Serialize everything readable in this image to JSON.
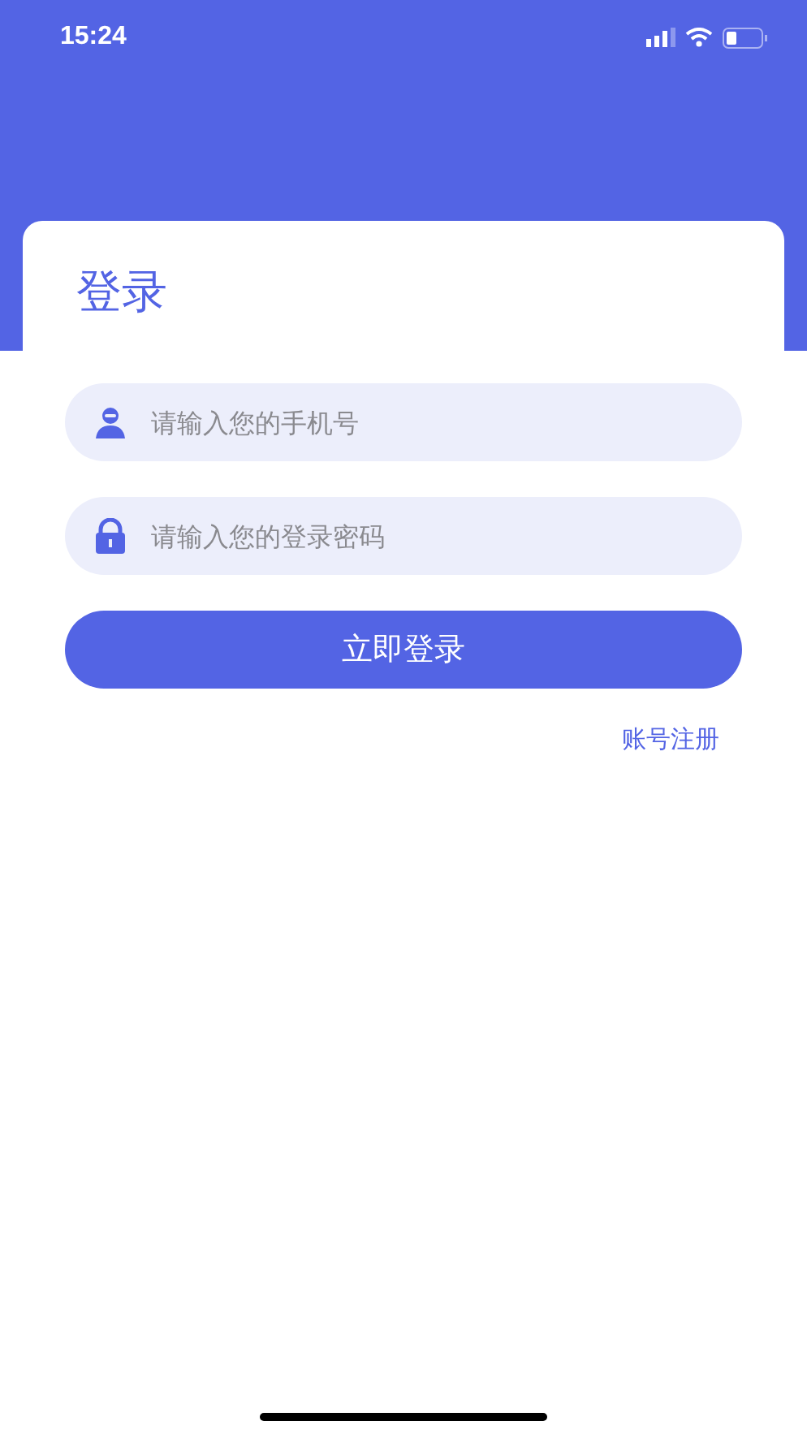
{
  "status_bar": {
    "time": "15:24"
  },
  "title": "登录",
  "fields": [
    {
      "kind": "phone",
      "placeholder": "请输入您的手机号"
    },
    {
      "kind": "password",
      "placeholder": "请输入您的登录密码"
    }
  ],
  "login_button": "立即登录",
  "register_link": "账号注册"
}
